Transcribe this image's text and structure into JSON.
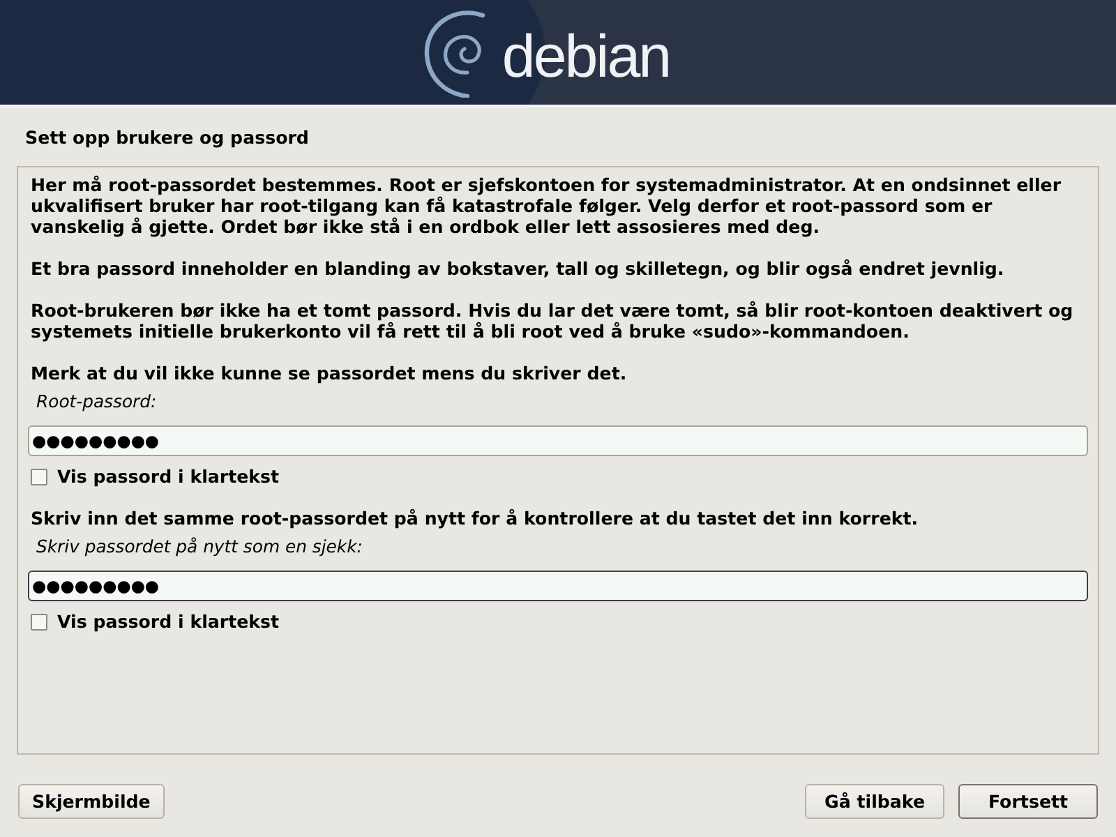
{
  "header": {
    "logo_text": "debian"
  },
  "page": {
    "title": "Sett opp brukere og passord"
  },
  "content": {
    "items": [
      {
        "kind": "paragraph",
        "text": "Her må root-passordet bestemmes. Root er sjefskontoen for systemadministrator. At en ondsinnet eller ukvalifisert bruker har root-tilgang kan få katastrofale følger. Velg derfor et root-passord som er vanskelig å gjette. Ordet bør ikke stå i en ordbok eller lett assosieres med deg."
      },
      {
        "kind": "paragraph",
        "text": "Et bra passord inneholder en blanding av bokstaver, tall og skilletegn, og blir også endret jevnlig."
      },
      {
        "kind": "paragraph",
        "text": "Root-brukeren bør ikke ha et tomt passord. Hvis du lar det være tomt, så blir root-kontoen deaktivert og systemets initielle brukerkonto vil få rett til å bli root ved å bruke «sudo»-kommandoen."
      },
      {
        "kind": "paragraph",
        "text": "Merk at du vil ikke kunne se passordet mens du skriver det."
      },
      {
        "kind": "password_field",
        "label": "Root-passord:",
        "value": "●●●●●●●●●",
        "focused": false
      },
      {
        "kind": "checkbox",
        "label": "Vis passord i klartekst",
        "checked": false
      },
      {
        "kind": "paragraph",
        "text": "Skriv inn det samme root-passordet på nytt for å kontrollere at du tastet det inn korrekt."
      },
      {
        "kind": "password_field",
        "label": "Skriv passordet på nytt som en sjekk:",
        "value": "●●●●●●●●●",
        "focused": true
      },
      {
        "kind": "checkbox",
        "label": "Vis passord i klartekst",
        "checked": false
      }
    ]
  },
  "buttons": {
    "left": [
      {
        "label": "Skjermbilde",
        "default": false
      }
    ],
    "right": [
      {
        "label": "Gå tilbake",
        "default": false
      },
      {
        "label": "Fortsett",
        "default": true
      }
    ]
  }
}
